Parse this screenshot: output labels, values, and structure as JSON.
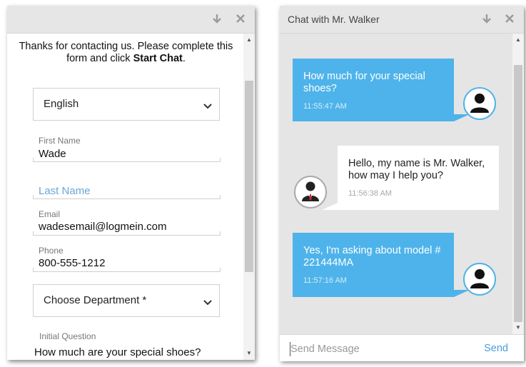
{
  "left_panel": {
    "intro_text": "Thanks for contacting us. Please complete this form and click",
    "intro_bold": "Start Chat",
    "intro_end": ".",
    "language_select": {
      "value": "English"
    },
    "first_name": {
      "label": "First Name",
      "value": "Wade"
    },
    "last_name": {
      "placeholder": "Last Name"
    },
    "email": {
      "label": "Email",
      "value": "wadesemail@logmein.com"
    },
    "phone": {
      "label": "Phone",
      "value": "800-555-1212"
    },
    "department_select": {
      "value": "Choose Department *"
    },
    "initial_question": {
      "label": "Initial Question",
      "value": "How much are your special shoes?"
    }
  },
  "right_panel": {
    "title": "Chat with Mr. Walker",
    "messages": [
      {
        "from": "user",
        "text_line1": "How much for your special",
        "text_line2": "shoes?",
        "time": "11:55:47 AM"
      },
      {
        "from": "agent",
        "text_line1": "Hello, my name is Mr. Walker,",
        "text_line2": "how may I help you?",
        "time": "11:56:38 AM"
      },
      {
        "from": "user",
        "text_line1": "Yes, I'm asking about model #",
        "text_line2": "221444MA",
        "time": "11:57:16 AM"
      }
    ],
    "composer": {
      "placeholder": "Send Message",
      "send_label": "Send"
    }
  },
  "icons": [
    "minimize-arrow-icon",
    "close-icon",
    "chevron-down-icon",
    "scroll-up-icon",
    "scroll-down-icon",
    "user-avatar-icon",
    "agent-avatar-icon"
  ],
  "colors": {
    "bubble_out": "#4eb3ea",
    "bubble_in": "#ffffff",
    "chat_bg": "#e5e5e5",
    "send_link": "#4a9fd8",
    "placeholder_blue": "#6aa6d4"
  }
}
